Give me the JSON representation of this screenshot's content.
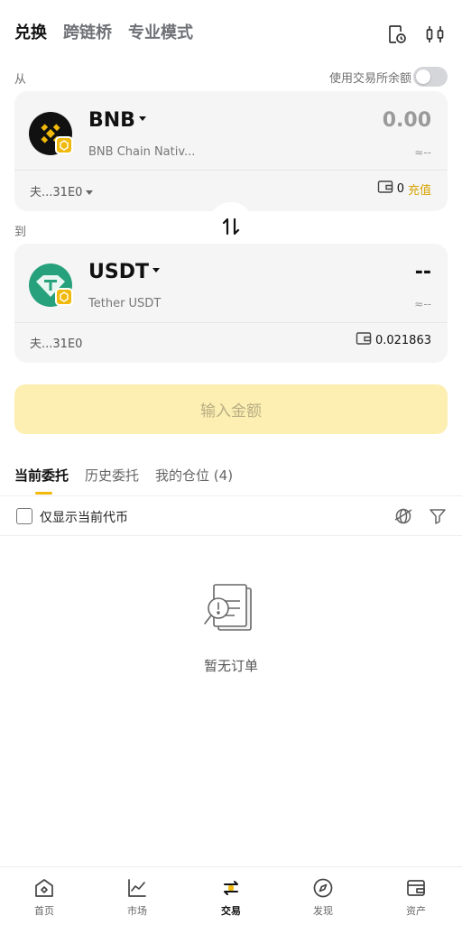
{
  "top_tabs": [
    "兑换",
    "跨链桥",
    "专业模式"
  ],
  "from_label": "从",
  "to_label": "到",
  "toggle_label": "使用交易所余额",
  "from": {
    "symbol": "BNB",
    "name": "BNB Chain Nativ...",
    "amount": "0.00",
    "approx": "≈--",
    "wallet": "夫...31E0",
    "balance": "0",
    "deposit": "充值"
  },
  "to": {
    "symbol": "USDT",
    "name": "Tether USDT",
    "amount": "--",
    "approx": "≈--",
    "wallet": "夫...31E0",
    "balance": "0.021863"
  },
  "main_button": "输入金额",
  "order_tabs": [
    "当前委托",
    "历史委托",
    "我的仓位 (4)"
  ],
  "only_current_label": "仅显示当前代币",
  "empty_text": "暂无订单",
  "bottom_nav": [
    "首页",
    "市场",
    "交易",
    "发现",
    "资产"
  ],
  "colors": {
    "accent": "#f0b90b",
    "bnb": "#f0b90b",
    "usdt": "#26a17b",
    "button_disabled_bg": "#fdefb2"
  },
  "icons": [
    "history-icon",
    "candlestick-icon",
    "wallet-icon",
    "swap-arrows-icon",
    "globe-icon",
    "filter-icon",
    "empty-document-icon",
    "home-icon",
    "market-chart-icon",
    "trade-icon",
    "discover-icon",
    "assets-icon"
  ]
}
